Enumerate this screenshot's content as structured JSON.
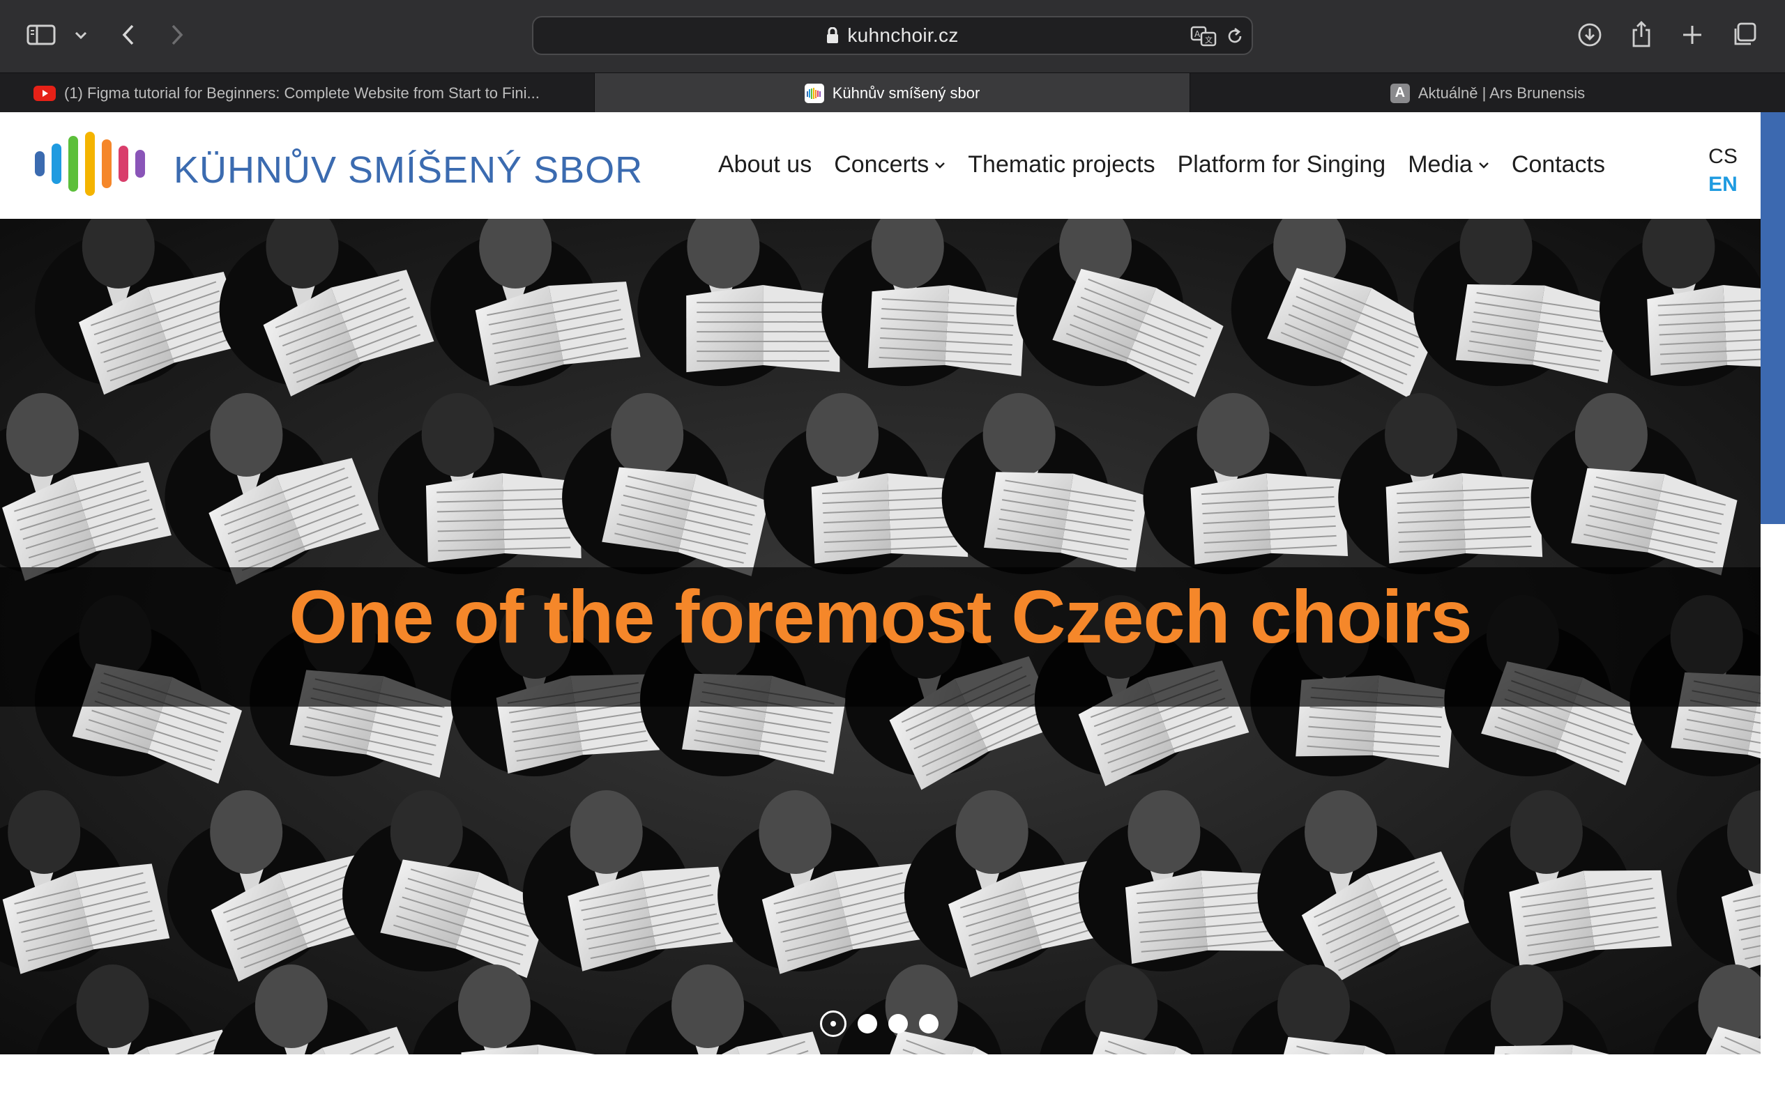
{
  "browser": {
    "url": "kuhnchoir.cz",
    "tabs": [
      {
        "title": "(1) Figma tutorial for Beginners: Complete Website from Start to Fini...",
        "favicon": "youtube-icon",
        "active": false
      },
      {
        "title": "Kühnův smíšený sbor",
        "favicon": "choir-logo-icon",
        "active": true
      },
      {
        "title": "Aktuálně | Ars Brunensis",
        "favicon": "letter-a-icon",
        "favicon_letter": "A",
        "active": false
      }
    ]
  },
  "site": {
    "logo_text": "KÜHNŮV SMÍŠENÝ SBOR",
    "logo_colors": [
      "#3b6bb0",
      "#1f9be0",
      "#5cbf3b",
      "#f4b400",
      "#f5872a",
      "#d93e6b",
      "#8a55b8"
    ],
    "nav": {
      "about": "About us",
      "concerts": "Concerts",
      "thematic": "Thematic projects",
      "platform": "Platform for Singing",
      "media": "Media",
      "contacts": "Contacts"
    },
    "lang": {
      "cs": "CS",
      "en": "EN",
      "active": "EN"
    }
  },
  "hero": {
    "caption": "One of the foremost Czech choirs",
    "slides_total": 4,
    "active_slide": 1,
    "caption_color": "#f5872a"
  }
}
